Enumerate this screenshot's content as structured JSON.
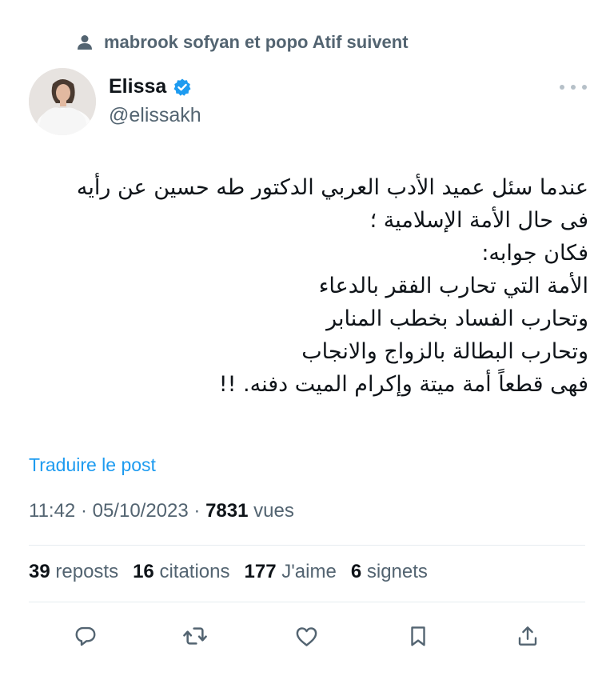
{
  "social_context": {
    "text": "mabrook sofyan et popo Atif suivent",
    "icon": "person-icon"
  },
  "author": {
    "name": "Elissa",
    "handle": "@elissakh",
    "verified_color": "#1d9bf0"
  },
  "tweet": {
    "lines": [
      "عندما سئل عميد الأدب العربي الدكتور طه حسين عن رأيه",
      "فى حال الأمة الإسلامية ؛",
      "فكان جوابه:",
      "الأمة التي تحارب الفقر بالدعاء",
      "وتحارب الفساد بخطب المنابر",
      "وتحارب البطالة بالزواج والانجاب",
      "فهى قطعاً أمة ميتة وإكرام الميت دفنه. !!"
    ],
    "translate_label": "Traduire le post",
    "time": "11:42",
    "date": "05/10/2023",
    "views_count": "7831",
    "views_label": "vues"
  },
  "stats": {
    "reposts_count": "39",
    "reposts_label": "reposts",
    "quotes_count": "16",
    "quotes_label": "citations",
    "likes_count": "177",
    "likes_label": "J'aime",
    "bookmarks_count": "6",
    "bookmarks_label": "signets"
  },
  "actions": [
    "reply-icon",
    "repost-icon",
    "like-icon",
    "bookmark-icon",
    "share-icon"
  ],
  "colors": {
    "accent": "#1d9bf0",
    "secondary_text": "#536471",
    "primary_text": "#0f1419"
  }
}
